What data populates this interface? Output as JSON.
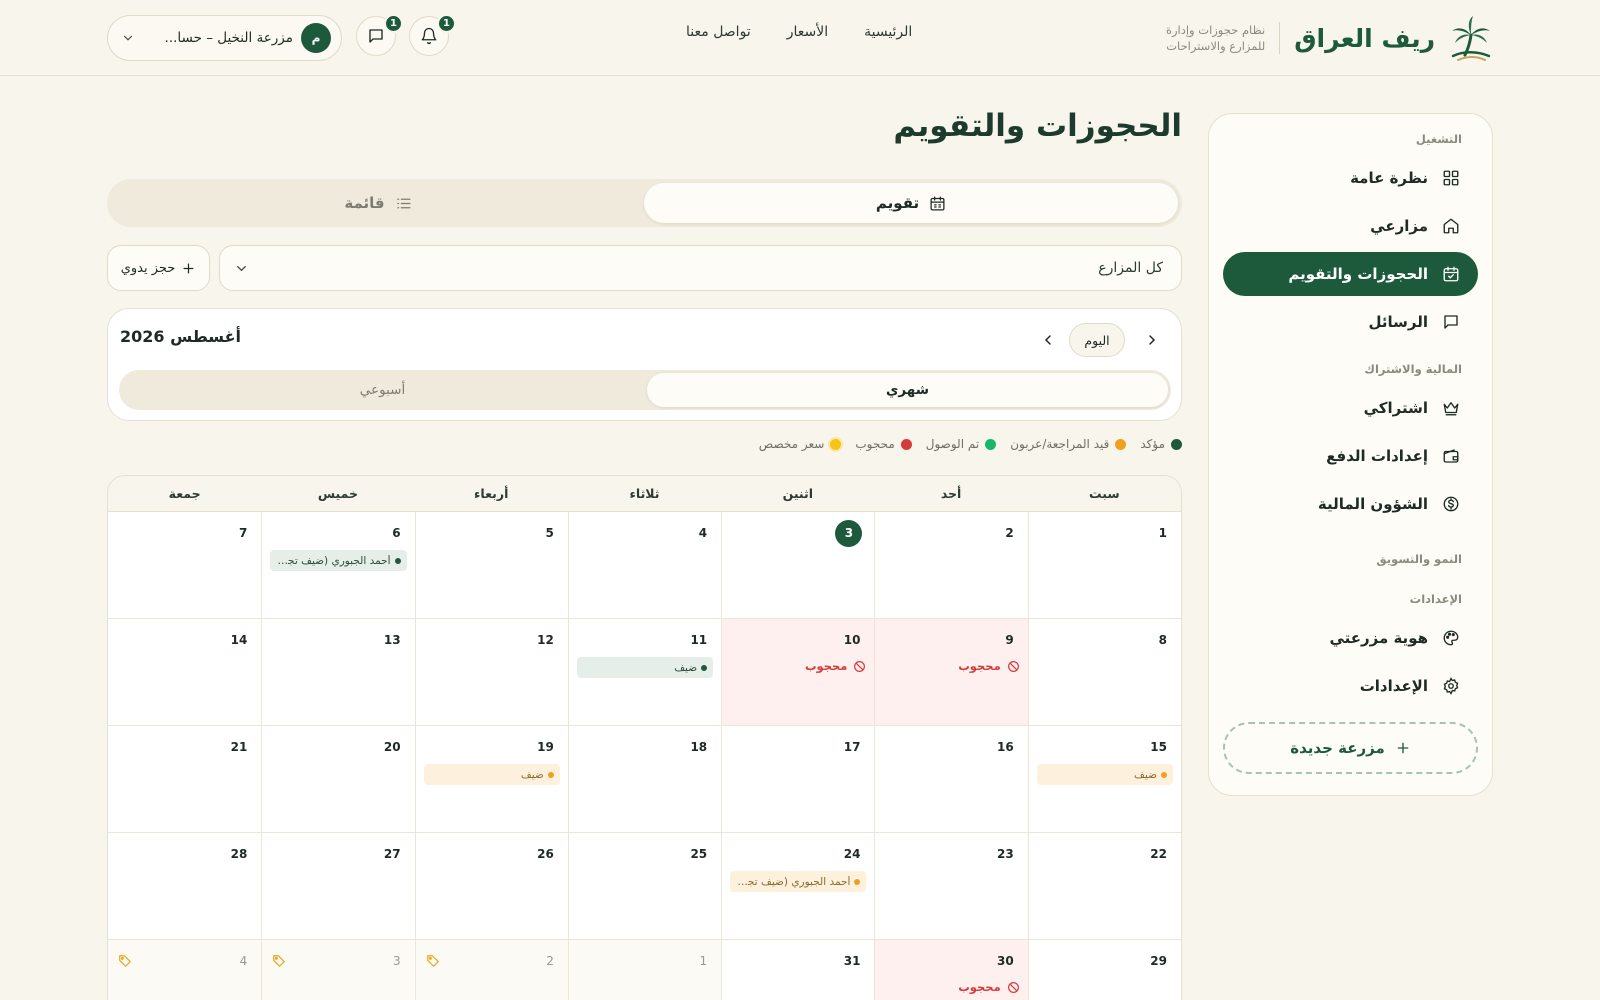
{
  "brand": {
    "name": "ريف العراق",
    "tagline": "نظام حجوزات وإدارة للمزارع والاستراحات"
  },
  "nav": [
    {
      "label": "الرئيسية"
    },
    {
      "label": "الأسعار"
    },
    {
      "label": "تواصل معنا"
    }
  ],
  "header": {
    "notifications_count": "1",
    "messages_count": "1",
    "farm_selector": {
      "avatar_letter": "م",
      "name": "مزرعة النخيل – حسا..."
    }
  },
  "sidebar": {
    "sections": [
      {
        "title": "التشغيل",
        "items": [
          {
            "label": "نظرة عامة",
            "icon": "grid-icon",
            "active": false
          },
          {
            "label": "مزارعي",
            "icon": "home-icon",
            "active": false
          },
          {
            "label": "الحجوزات والتقويم",
            "icon": "calendar-check-icon",
            "active": true
          },
          {
            "label": "الرسائل",
            "icon": "message-icon",
            "active": false
          }
        ]
      },
      {
        "title": "المالية والاشتراك",
        "items": [
          {
            "label": "اشتراكي",
            "icon": "crown-icon",
            "active": false
          },
          {
            "label": "إعدادات الدفع",
            "icon": "wallet-icon",
            "active": false
          },
          {
            "label": "الشؤون المالية",
            "icon": "dollar-icon",
            "active": false
          }
        ]
      },
      {
        "title": "النمو والتسويق",
        "items": []
      },
      {
        "title": "الإعدادات",
        "items": [
          {
            "label": "هوية مزرعتي",
            "icon": "palette-icon",
            "active": false
          },
          {
            "label": "الإعدادات",
            "icon": "gear-icon",
            "active": false
          }
        ]
      }
    ],
    "new_farm_label": "مزرعة جديدة"
  },
  "main": {
    "title": "الحجوزات والتقويم",
    "view_tabs": {
      "calendar": "تقويم",
      "list": "قائمة"
    },
    "farm_filter": "كل المزارع",
    "manual_booking": "حجز يدوي",
    "month_label": "أغسطس 2026",
    "today_button": "اليوم",
    "calendar_modes": {
      "monthly": "شهري",
      "weekly": "أسبوعي"
    }
  },
  "legend": [
    {
      "label": "مؤكد",
      "color": "#1d5a3c"
    },
    {
      "label": "قيد المراجعة/عربون",
      "color": "#f0a020"
    },
    {
      "label": "تم الوصول",
      "color": "#19b56b"
    },
    {
      "label": "محجوب",
      "color": "#d63b3b"
    },
    {
      "label": "سعر مخصص",
      "color": "#f5c518"
    }
  ],
  "colors": {
    "accent": "#1d5a3c",
    "blocked": "#d63b3b",
    "pending": "#f0a020"
  },
  "weekdays": [
    "سبت",
    "أحد",
    "اثنين",
    "ثلاثاء",
    "أربعاء",
    "خميس",
    "جمعة"
  ],
  "blocked_label": "محجوب",
  "weeks": [
    [
      {
        "day": "1"
      },
      {
        "day": "2"
      },
      {
        "day": "3",
        "today": true
      },
      {
        "day": "4"
      },
      {
        "day": "5"
      },
      {
        "day": "6",
        "booking": {
          "text": "أحمد الجبوري (ضيف تجريبي)",
          "status": "confirmed"
        }
      },
      {
        "day": "7"
      }
    ],
    [
      {
        "day": "8"
      },
      {
        "day": "9",
        "blocked": true
      },
      {
        "day": "10",
        "blocked": true
      },
      {
        "day": "11",
        "booking": {
          "text": "ضيف",
          "status": "confirmed"
        }
      },
      {
        "day": "12"
      },
      {
        "day": "13"
      },
      {
        "day": "14"
      }
    ],
    [
      {
        "day": "15",
        "booking": {
          "text": "ضيف",
          "status": "pending"
        }
      },
      {
        "day": "16"
      },
      {
        "day": "17"
      },
      {
        "day": "18"
      },
      {
        "day": "19",
        "booking": {
          "text": "ضيف",
          "status": "pending"
        }
      },
      {
        "day": "20"
      },
      {
        "day": "21"
      }
    ],
    [
      {
        "day": "22"
      },
      {
        "day": "23"
      },
      {
        "day": "24",
        "booking": {
          "text": "أحمد الجبوري (ضيف تجريبي)",
          "status": "pending"
        }
      },
      {
        "day": "25"
      },
      {
        "day": "26"
      },
      {
        "day": "27"
      },
      {
        "day": "28"
      }
    ],
    [
      {
        "day": "29"
      },
      {
        "day": "30",
        "blocked": true
      },
      {
        "day": "31"
      },
      {
        "day": "1",
        "outside": true
      },
      {
        "day": "2",
        "outside": true,
        "custom_price": true
      },
      {
        "day": "3",
        "outside": true,
        "custom_price": true
      },
      {
        "day": "4",
        "outside": true,
        "custom_price": true
      }
    ]
  ]
}
